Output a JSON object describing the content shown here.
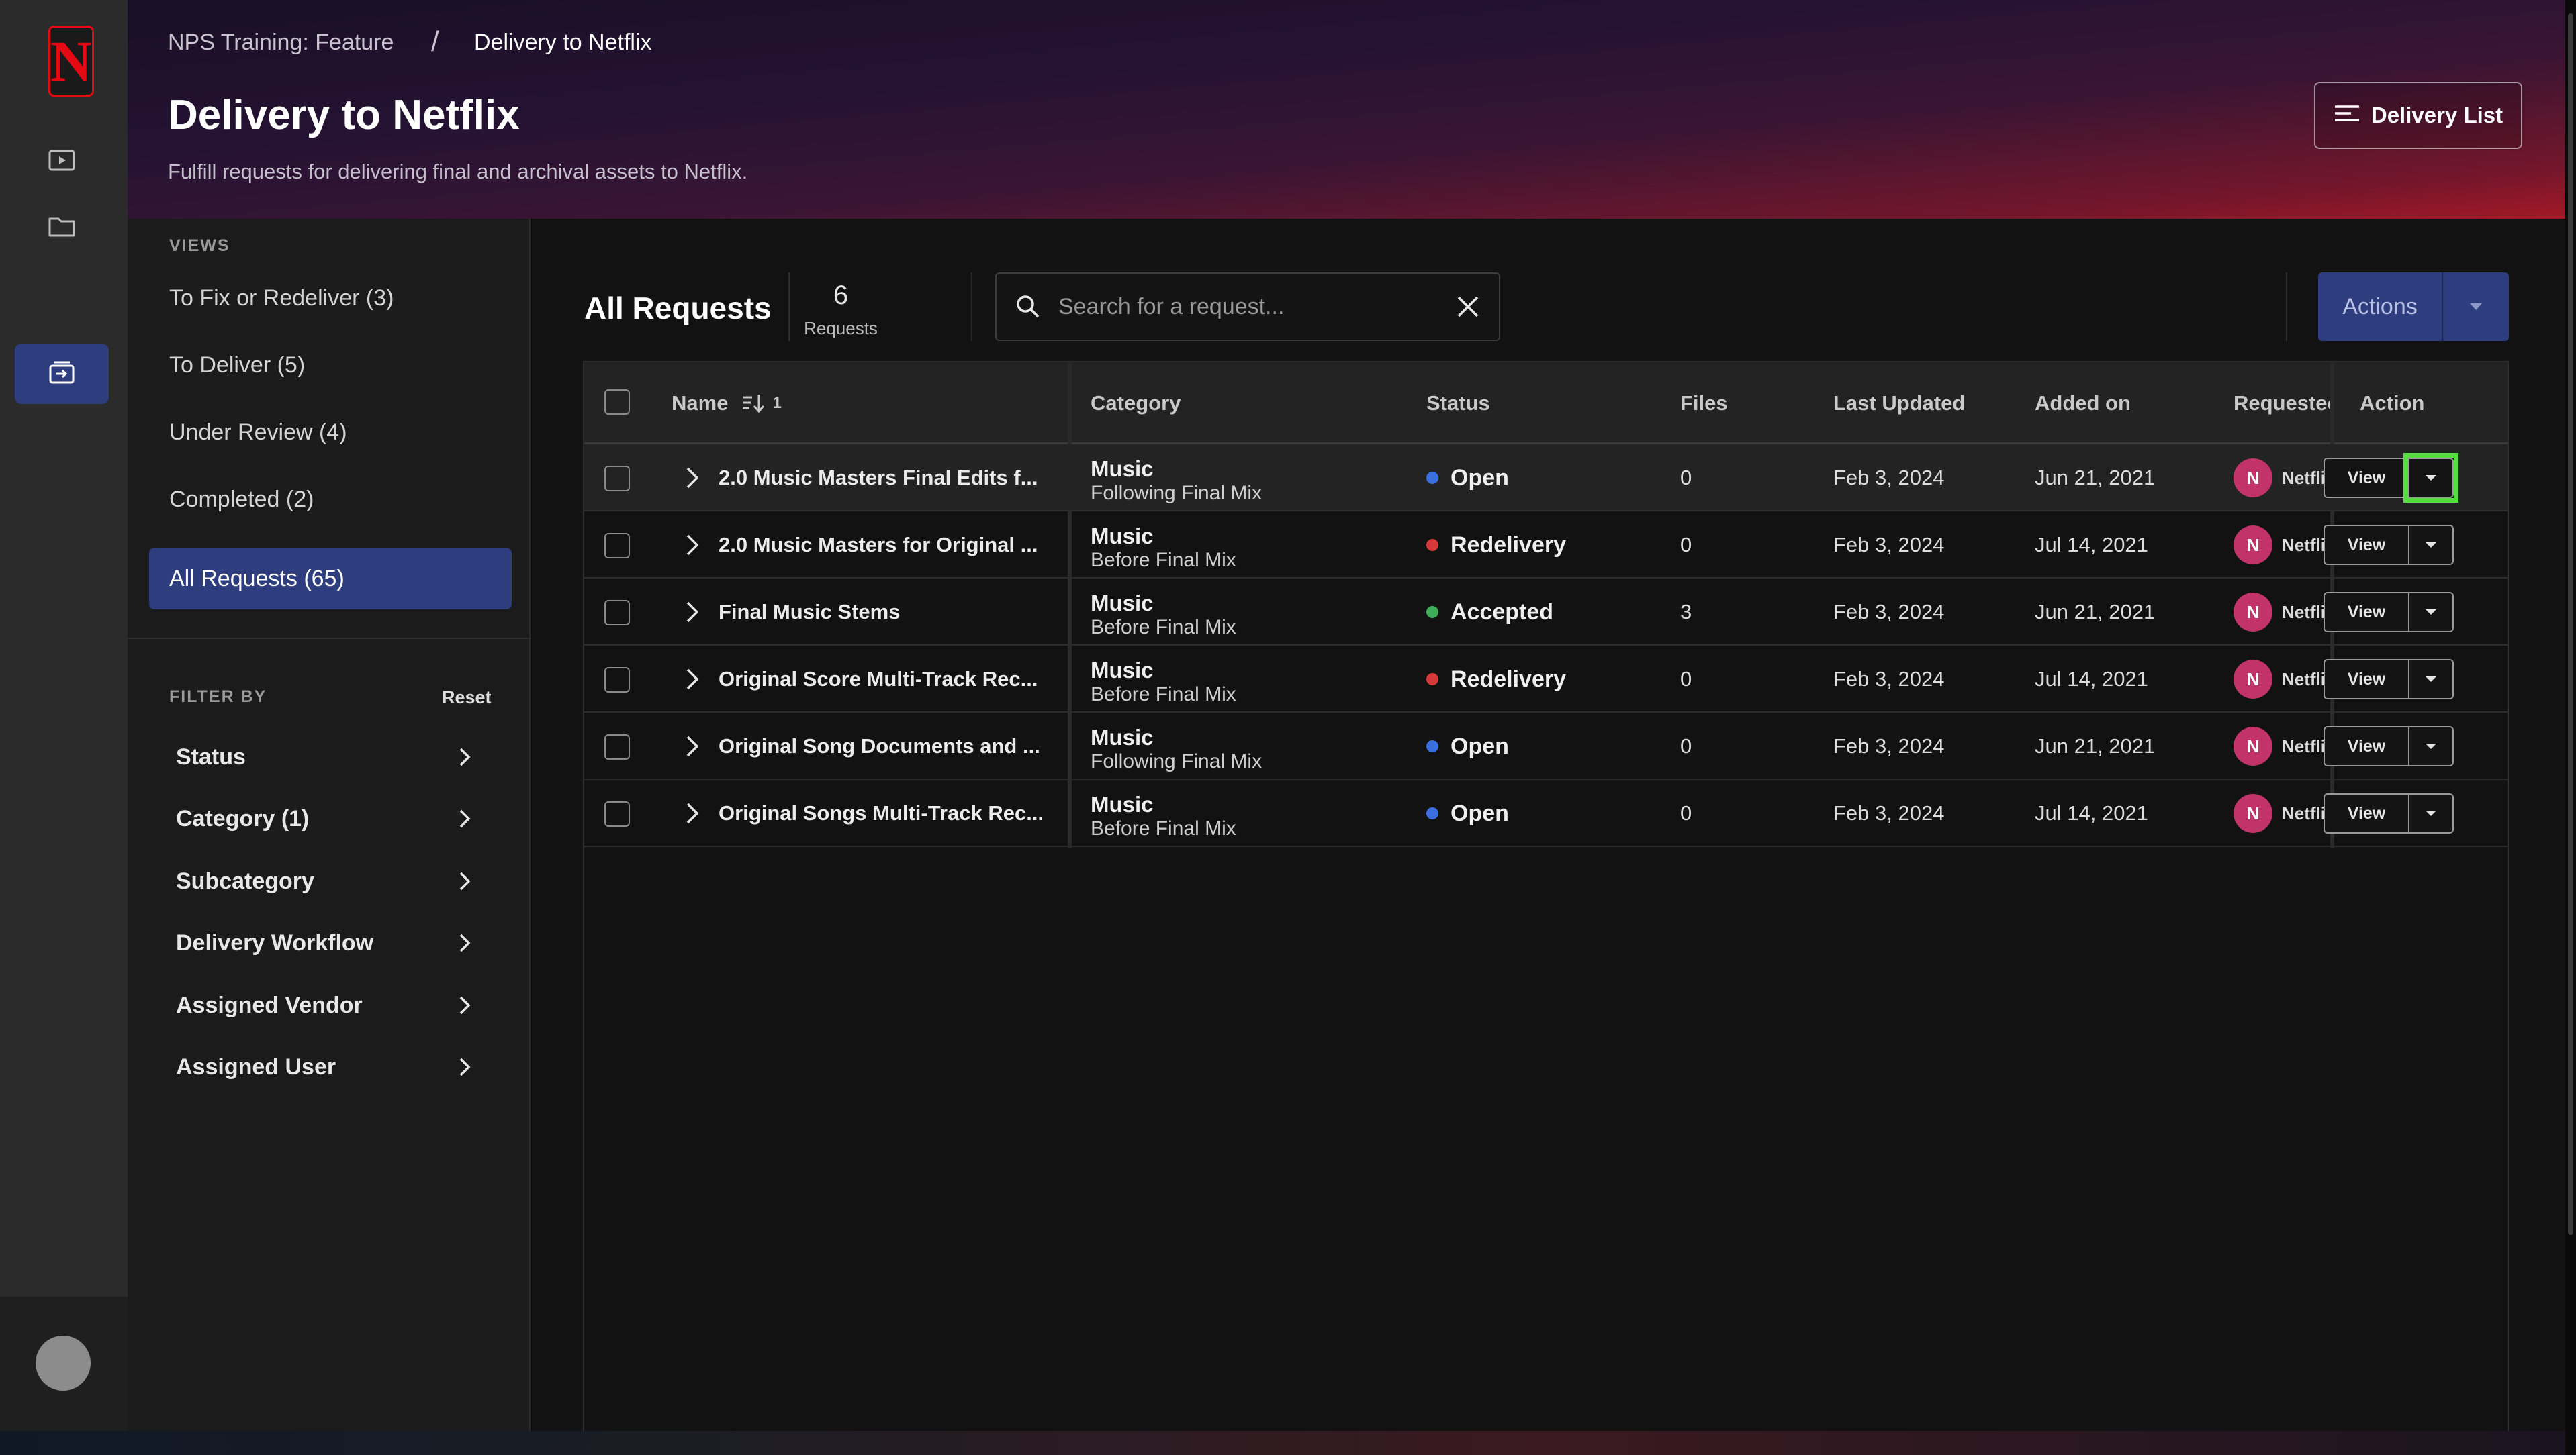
{
  "app": {
    "logo_letter": "N",
    "accent_color": "#e50914",
    "brand_blue": "#2e3d7e"
  },
  "breadcrumb": {
    "parent": "NPS Training: Feature",
    "separator": "/",
    "current": "Delivery to Netflix"
  },
  "header": {
    "title": "Delivery to Netflix",
    "subtitle": "Fulfill requests for delivering final and archival assets to Netflix.",
    "delivery_list_label": "Delivery List"
  },
  "sidebar": {
    "views_label": "VIEWS",
    "views": [
      {
        "label": "To Fix or Redeliver (3)",
        "active": false
      },
      {
        "label": "To Deliver (5)",
        "active": false
      },
      {
        "label": "Under Review (4)",
        "active": false
      },
      {
        "label": "Completed (2)",
        "active": false
      },
      {
        "label": "All Requests (65)",
        "active": true
      }
    ],
    "filter_label": "FILTER BY",
    "reset_label": "Reset",
    "filters": [
      {
        "label": "Status"
      },
      {
        "label": "Category (1)"
      },
      {
        "label": "Subcategory"
      },
      {
        "label": "Delivery Workflow"
      },
      {
        "label": "Assigned Vendor"
      },
      {
        "label": "Assigned User"
      }
    ]
  },
  "main": {
    "title": "All Requests",
    "count": "6",
    "count_label": "Requests",
    "search_placeholder": "Search for a request...",
    "actions_label": "Actions"
  },
  "table": {
    "columns": {
      "name": "Name",
      "sort_indicator": "1",
      "category": "Category",
      "status": "Status",
      "files": "Files",
      "last_updated": "Last Updated",
      "added_on": "Added on",
      "requested": "Requestec",
      "action": "Action"
    },
    "status_colors": {
      "Open": "#3b6fe0",
      "Redelivery": "#d43a3a",
      "Accepted": "#3fae5a"
    },
    "rows": [
      {
        "name": "2.0 Music Masters Final Edits f...",
        "category": "Music",
        "subcategory": "Following Final Mix",
        "status": "Open",
        "files": "0",
        "last_updated": "Feb 3, 2024",
        "added_on": "Jun 21, 2021",
        "requester_initial": "N",
        "requester": "Netflix",
        "action": "View"
      },
      {
        "name": "2.0 Music Masters for Original ...",
        "category": "Music",
        "subcategory": "Before Final Mix",
        "status": "Redelivery",
        "files": "0",
        "last_updated": "Feb 3, 2024",
        "added_on": "Jul 14, 2021",
        "requester_initial": "N",
        "requester": "Netflix",
        "action": "View"
      },
      {
        "name": "Final Music Stems",
        "category": "Music",
        "subcategory": "Before Final Mix",
        "status": "Accepted",
        "files": "3",
        "last_updated": "Feb 3, 2024",
        "added_on": "Jun 21, 2021",
        "requester_initial": "N",
        "requester": "Netflix",
        "action": "View"
      },
      {
        "name": "Original Score Multi-Track Rec...",
        "category": "Music",
        "subcategory": "Before Final Mix",
        "status": "Redelivery",
        "files": "0",
        "last_updated": "Feb 3, 2024",
        "added_on": "Jul 14, 2021",
        "requester_initial": "N",
        "requester": "Netflix",
        "action": "View"
      },
      {
        "name": "Original Song Documents and ...",
        "category": "Music",
        "subcategory": "Following Final Mix",
        "status": "Open",
        "files": "0",
        "last_updated": "Feb 3, 2024",
        "added_on": "Jun 21, 2021",
        "requester_initial": "N",
        "requester": "Netflix",
        "action": "View"
      },
      {
        "name": "Original Songs Multi-Track Rec...",
        "category": "Music",
        "subcategory": "Before Final Mix",
        "status": "Open",
        "files": "0",
        "last_updated": "Feb 3, 2024",
        "added_on": "Jul 14, 2021",
        "requester_initial": "N",
        "requester": "Netflix",
        "action": "View"
      }
    ]
  }
}
